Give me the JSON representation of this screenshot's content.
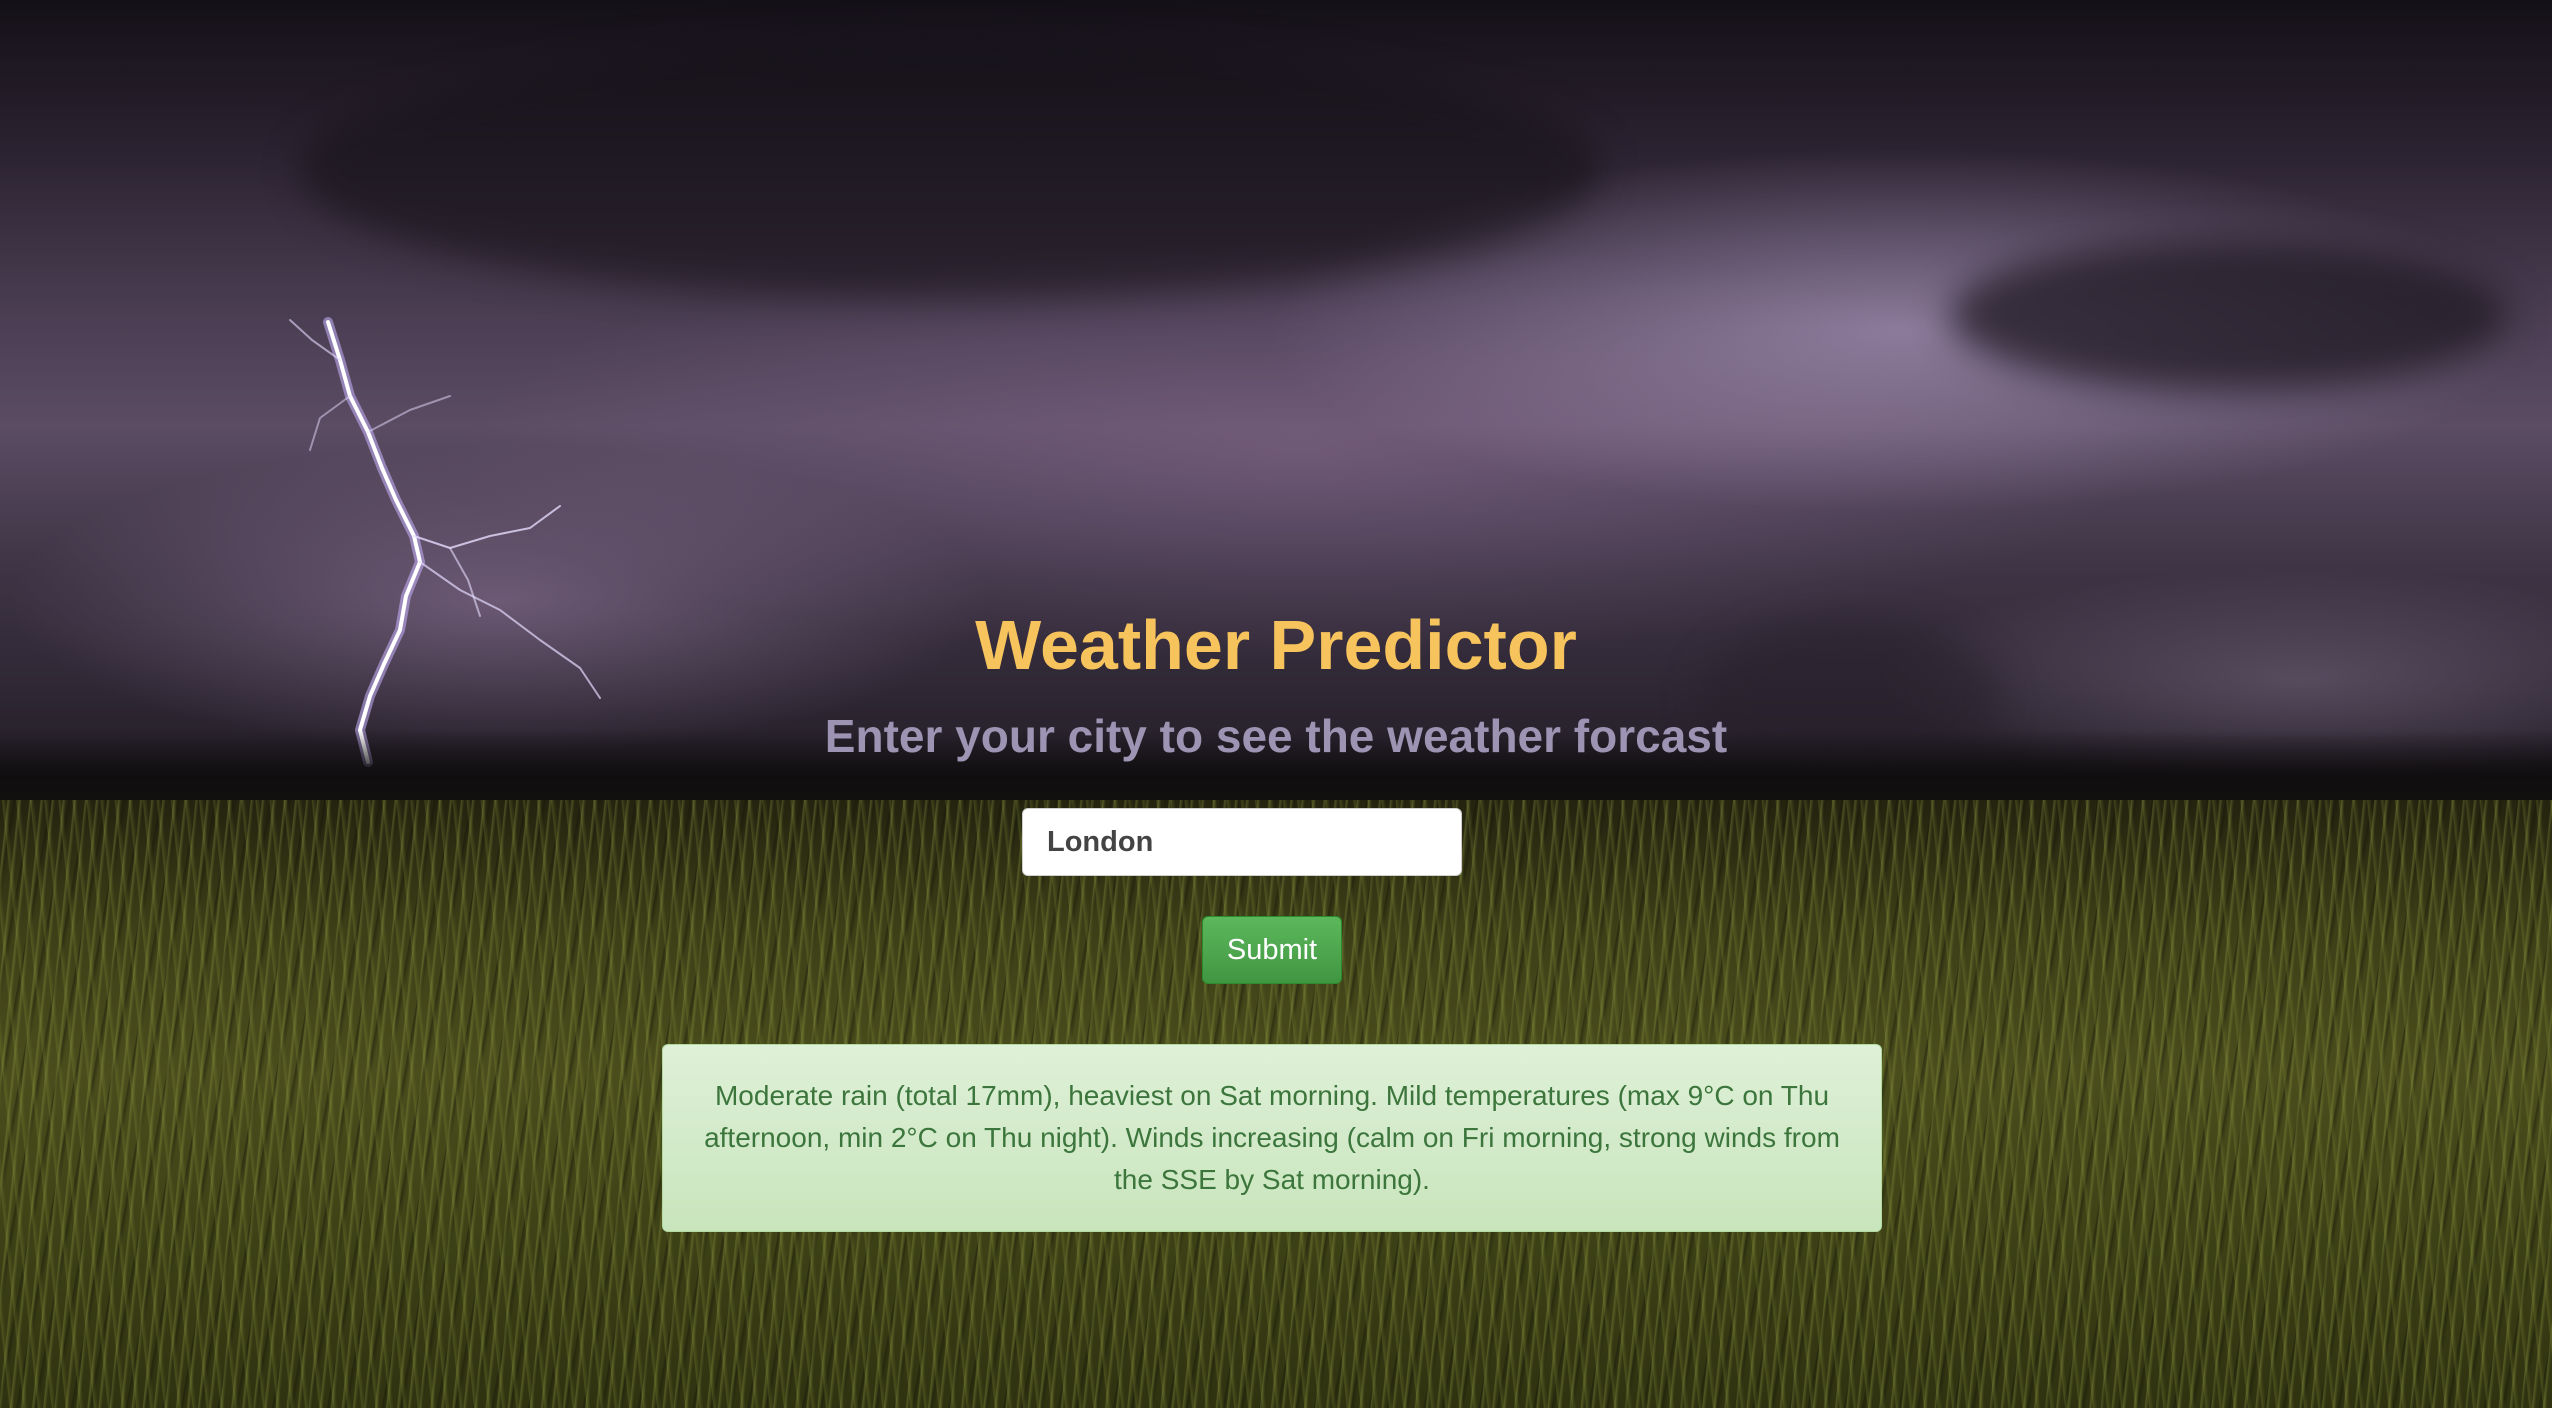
{
  "page": {
    "title": "Weather Predictor",
    "subtitle": "Enter your city to see the weather forcast"
  },
  "form": {
    "city_value": "London",
    "submit_label": "Submit"
  },
  "forecast": {
    "text": "Moderate rain (total 17mm), heaviest on Sat morning. Mild temperatures (max 9°C on Thu afternoon, min 2°C on Thu night). Winds increasing (calm on Fri morning, strong winds from the SSE by Sat morning)."
  },
  "background": {
    "image": "lightning-storm-over-grass-field"
  },
  "colors": {
    "title": "#f6c35c",
    "subtitle": "#9d93b2",
    "submit_button": "#5cb85c",
    "forecast_background": "#dff0d8",
    "forecast_text": "#3c763d"
  }
}
